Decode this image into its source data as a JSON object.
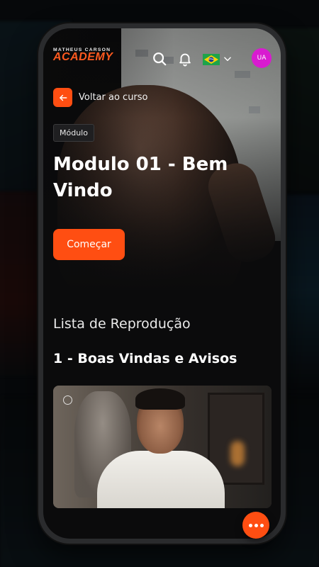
{
  "brand": {
    "logo_top": "MATHEUS CARSON",
    "logo_main": "ACADEMY"
  },
  "header": {
    "avatar_initials": "UA",
    "language_flag": "brazil-flag-icon"
  },
  "hero": {
    "back_label": "Voltar ao curso",
    "badge": "Módulo",
    "title": "Modulo 01 - Bem Vindo",
    "cta_label": "Começar"
  },
  "playlist": {
    "heading": "Lista de Reprodução",
    "lesson_title": "1 - Boas Vindas e Avisos"
  },
  "colors": {
    "accent": "#ff4e12",
    "avatar": "#d81bd0",
    "background": "#0b0b0c"
  }
}
